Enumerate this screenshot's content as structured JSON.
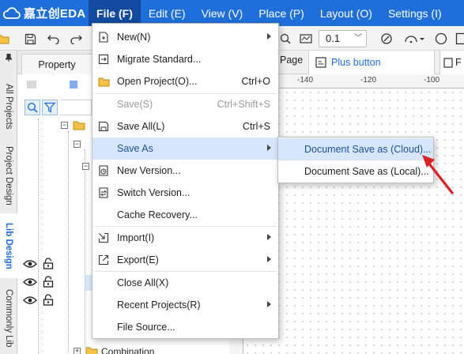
{
  "app": {
    "logo_text": "嘉立创EDA",
    "menus": [
      "File (F)",
      "Edit (E)",
      "View (V)",
      "Place (P)",
      "Layout (O)",
      "Settings (I)"
    ]
  },
  "toolbar": {
    "zoom_value": "0.1"
  },
  "left_tabs": [
    "All Projects",
    "Project Design",
    "Lib Design",
    "Commonly Lib"
  ],
  "left_panel": {
    "tab_label": "Property",
    "tree_bottom_label": "Combination"
  },
  "canvas": {
    "tab_page": "Page",
    "tab_active": "Plus button",
    "tab_next": "F",
    "ruler_labels": [
      "-140",
      "-120",
      "-100"
    ]
  },
  "file_menu": {
    "items": [
      {
        "label": "New(N)",
        "shortcut": "",
        "icon": "new-file-icon",
        "disabled": false,
        "submenu": true
      },
      {
        "label": "Migrate Standard...",
        "shortcut": "",
        "icon": "migrate-icon",
        "disabled": false,
        "submenu": false
      },
      {
        "label": "Open Project(O)...",
        "shortcut": "Ctrl+O",
        "icon": "folder-icon",
        "disabled": false,
        "submenu": false
      },
      {
        "label": "Save(S)",
        "shortcut": "Ctrl+Shift+S",
        "icon": "",
        "disabled": true,
        "submenu": false
      },
      {
        "label": "Save All(L)",
        "shortcut": "Ctrl+S",
        "icon": "save-all-icon",
        "disabled": false,
        "submenu": false
      },
      {
        "label": "Save As",
        "shortcut": "",
        "icon": "",
        "disabled": false,
        "submenu": true
      },
      {
        "label": "New Version...",
        "shortcut": "",
        "icon": "new-version-icon",
        "disabled": false,
        "submenu": false
      },
      {
        "label": "Switch Version...",
        "shortcut": "",
        "icon": "switch-version-icon",
        "disabled": false,
        "submenu": false
      },
      {
        "label": "Cache Recovery...",
        "shortcut": "",
        "icon": "",
        "disabled": false,
        "submenu": false
      },
      {
        "label": "Import(I)",
        "shortcut": "",
        "icon": "import-icon",
        "disabled": false,
        "submenu": true
      },
      {
        "label": "Export(E)",
        "shortcut": "",
        "icon": "export-icon",
        "disabled": false,
        "submenu": true
      },
      {
        "label": "Close All(X)",
        "shortcut": "",
        "icon": "",
        "disabled": false,
        "submenu": false
      },
      {
        "label": "Recent Projects(R)",
        "shortcut": "",
        "icon": "",
        "disabled": false,
        "submenu": true
      },
      {
        "label": "File Source...",
        "shortcut": "",
        "icon": "",
        "disabled": false,
        "submenu": false
      }
    ]
  },
  "save_as_submenu": {
    "items": [
      "Document Save as (Cloud)...",
      "Document Save as (Local)..."
    ]
  },
  "colors": {
    "brand_blue": "#1e6fd9",
    "active_menu": "#114a9e",
    "hover": "#d7e7fb",
    "annotation_red": "#e02020"
  }
}
